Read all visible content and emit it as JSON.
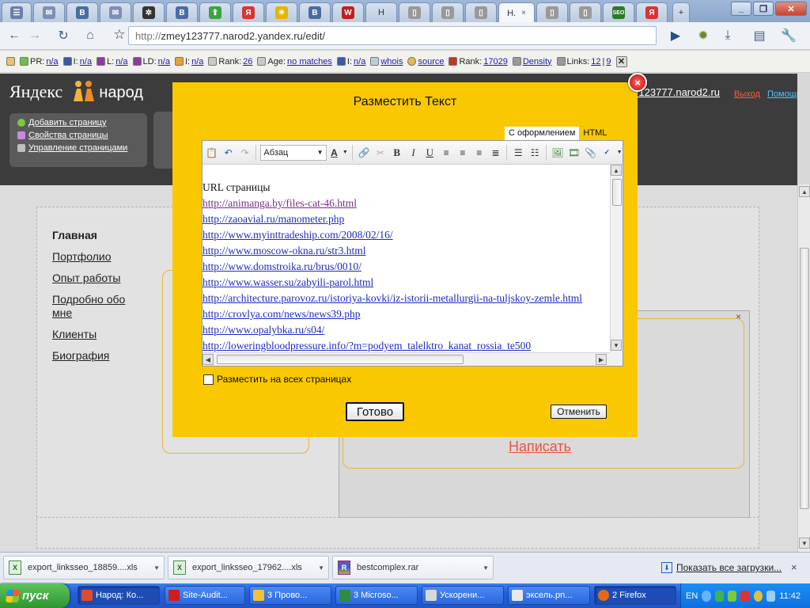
{
  "browser": {
    "tabs": [
      {
        "label": "",
        "icon": "doc-icon",
        "color": "#6b7fa6"
      },
      {
        "label": "",
        "icon": "mail-icon",
        "color": "#7d8fb5"
      },
      {
        "label": "",
        "icon": "vk-icon",
        "color": "#4a6d9e"
      },
      {
        "label": "",
        "icon": "mail-icon",
        "color": "#7d8fb5"
      },
      {
        "label": "",
        "icon": "pinwheel-icon",
        "color": "#333"
      },
      {
        "label": "",
        "icon": "vk-icon",
        "color": "#4a6d9e"
      },
      {
        "label": "",
        "icon": "green-arrow-icon",
        "color": "#3fa33f"
      },
      {
        "label": "",
        "icon": "yandex-icon",
        "color": "#d33"
      },
      {
        "label": "",
        "icon": "sun-icon",
        "color": "#e7b500"
      },
      {
        "label": "",
        "icon": "vk-icon",
        "color": "#4a6d9e"
      },
      {
        "label": "",
        "icon": "w-icon",
        "color": "#c02020"
      },
      {
        "label": "Н",
        "icon": "",
        "color": ""
      },
      {
        "label": "",
        "icon": "page-icon",
        "color": "#999"
      },
      {
        "label": "",
        "icon": "page-icon",
        "color": "#999"
      },
      {
        "label": "",
        "icon": "page-icon",
        "color": "#999"
      },
      {
        "label": "Н.",
        "icon": "",
        "color": ""
      },
      {
        "label": "",
        "icon": "page-icon",
        "color": "#999"
      },
      {
        "label": "",
        "icon": "page-icon",
        "color": "#999"
      },
      {
        "label": "",
        "icon": "seo-icon",
        "color": "#2a7a2a"
      },
      {
        "label": "",
        "icon": "yandex-icon",
        "color": "#d33"
      }
    ],
    "url_scheme": "http://",
    "url_rest": "zmey123777.narod2.yandex.ru/edit/"
  },
  "seobar": {
    "pr_label": "PR:",
    "pr_value": "n/a",
    "i_label": "I:",
    "i_value": "n/a",
    "l_label": "L:",
    "l_value": "n/a",
    "ld_label": "LD:",
    "ld_value": "n/a",
    "i2_label": "I:",
    "i2_value": "n/a",
    "rank_label": "Rank:",
    "rank_value": "26",
    "age_label": "Age:",
    "age_value": "no matches",
    "i3_label": "I:",
    "i3_value": "n/a",
    "whois": "whois",
    "source": "source",
    "rank2_label": "Rank:",
    "rank2_value": "17029",
    "density": "Density",
    "links_label": "Links:",
    "links_value1": "12",
    "links_sep": "|",
    "links_value2": "9"
  },
  "yandex": {
    "logo_text": "Яндекс",
    "service_text": "народ",
    "pages_menu": [
      {
        "label": "Добавить страницу",
        "color": "#7ec83a"
      },
      {
        "label": "Свойства страницы",
        "color": "#c58be0"
      },
      {
        "label": "Управление страницами",
        "color": "#bfbfbf"
      }
    ],
    "user_link": "ey123777.narod2.ru",
    "exit_link": "Выход",
    "help_link": "Помощь",
    "site_nav": [
      {
        "label": "Главная",
        "current": true
      },
      {
        "label": "Портфолио",
        "current": false
      },
      {
        "label": "Опыт работы",
        "current": false
      },
      {
        "label": "Подробно обо мне",
        "current": false
      },
      {
        "label": "Клиенты",
        "current": false
      },
      {
        "label": "Биография",
        "current": false
      }
    ],
    "write_link": "Написать",
    "panel_close": "×"
  },
  "dialog": {
    "title": "Разместить Текст",
    "close": "×",
    "mode_tabs": {
      "visual": "С оформлением",
      "html": "HTML"
    },
    "format_select": "Абзац",
    "content_heading": "URL страницы",
    "links": [
      {
        "url": "http://animanga.by/files-cat-46.html",
        "visited": true
      },
      {
        "url": "http://zaoavial.ru/manometer.php",
        "visited": false
      },
      {
        "url": "http://www.myinttradeship.com/2008/02/16/",
        "visited": false
      },
      {
        "url": "http://www.moscow-okna.ru/str3.html",
        "visited": false
      },
      {
        "url": "http://www.domstroika.ru/brus/0010/",
        "visited": false
      },
      {
        "url": "http://www.wasser.su/zabyili-parol.html",
        "visited": false
      },
      {
        "url": "http://architecture.parovoz.ru/istoriya-kovki/iz-istorii-metallurgii-na-tuljskoy-zemle.html",
        "visited": false
      },
      {
        "url": "http://crovlya.com/news/news39.php",
        "visited": false
      },
      {
        "url": "http://www.opalybka.ru/s04/",
        "visited": false
      },
      {
        "url": "http://loweringbloodpressure.info/?m=podyem_talelktro_kanat_rossia_te500",
        "visited": false
      }
    ],
    "place_all_label": "Разместить на всех страницах",
    "done_label": "Готово",
    "cancel_label": "Отменить"
  },
  "downloads": {
    "items": [
      "export_linksseo_18859....xls",
      "export_linksseo_17962....xls",
      "bestcomplex.rar"
    ],
    "show_all": "Показать все загрузки...",
    "close": "×"
  },
  "taskbar": {
    "start_label": "пуск",
    "tasks": [
      {
        "label": "Народ: Ко...",
        "color": "#e04b2c",
        "active": true
      },
      {
        "label": "Site-Audit...",
        "color": "#cc1e1e",
        "active": false
      },
      {
        "label": "3 Прово...",
        "color": "#f2c23a",
        "active": false
      },
      {
        "label": "3 Microso...",
        "color": "#2e8c3b",
        "active": false
      },
      {
        "label": "Ускорени...",
        "color": "#d8d8d8",
        "active": false
      },
      {
        "label": "эксель.pn...",
        "color": "#e8e8e8",
        "active": false
      },
      {
        "label": "2 Firefox",
        "color": "#e56a17",
        "active": true
      }
    ],
    "lang": "EN",
    "clock": "11:42"
  }
}
